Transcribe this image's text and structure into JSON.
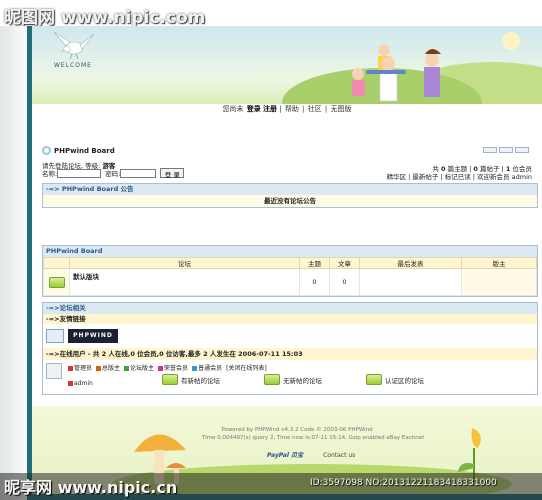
{
  "watermark": {
    "top": "昵图网 www.nipic.com",
    "bottom_site": "昵享网 www.nipic.cn",
    "bottom_id": "ID:3597098 NO:20131221183418331000"
  },
  "header": {
    "welcome": "WELCOME",
    "nav": {
      "greeting": "您尚未",
      "login": "登录",
      "register": "注册",
      "help": "帮助",
      "community": "社区",
      "boardless": "无图版"
    }
  },
  "board": {
    "title": "PHPwind Board",
    "login_prompt": "请先登陆论坛, 等级:",
    "guest": "游客",
    "username_label": "名称:",
    "password_label": "密码:",
    "login_button": "登 录",
    "stats": {
      "p1": "共",
      "topics": "0",
      "p2": "篇主题",
      "p3": "|",
      "posts": "0",
      "p4": "篇帖子",
      "p5": "|",
      "members": "1",
      "p6": "位会员"
    },
    "links": {
      "digest": "精华区",
      "latest": "最新帖子",
      "mark_read": "标记已读",
      "welcome_member": "欢迎新会员",
      "member_name": "admin"
    }
  },
  "notice": {
    "header": "-=> PHPwind Board 公告",
    "body": "最近没有论坛公告"
  },
  "forum_table": {
    "header": "PHPwind Board",
    "columns": [
      "论坛",
      "主题",
      "文章",
      "最后发表",
      "版主"
    ],
    "rows": [
      {
        "name": "默认版块",
        "topics": "0",
        "posts": "0",
        "last": "",
        "moderator": ""
      }
    ]
  },
  "related": {
    "header": "-=>论坛相关",
    "friend_links": "-=>友情链接",
    "pw_logo": "PHPWIND",
    "online": "-=>在线用户 - 共 2 人在线,0 位会员,0 位访客,最多 2 人发生在 2006-07-11 15:03",
    "legend": [
      "管理员",
      "总版主",
      "论坛版主",
      "荣誉会员",
      "普通会员",
      "[关闭在线列表]"
    ],
    "online_user": "admin"
  },
  "legend_colors": [
    "#d33",
    "#c60",
    "#3a3",
    "#c39",
    "#39c"
  ],
  "footer_icons": {
    "new": "有新帖的论坛",
    "none": "无新帖的论坛",
    "verified": "认证区的论坛"
  },
  "footer": {
    "powered_line1": "Powered by PHPWind v4.3.2 Code © 2003-06 PHPWind",
    "powered_line2": "Time 0.004497(s) query 2, Time now is:07-11 15:14, Gzip enabled eBay Eachnet",
    "paypal": "PayPal 贝宝",
    "contact": "Contact us"
  }
}
